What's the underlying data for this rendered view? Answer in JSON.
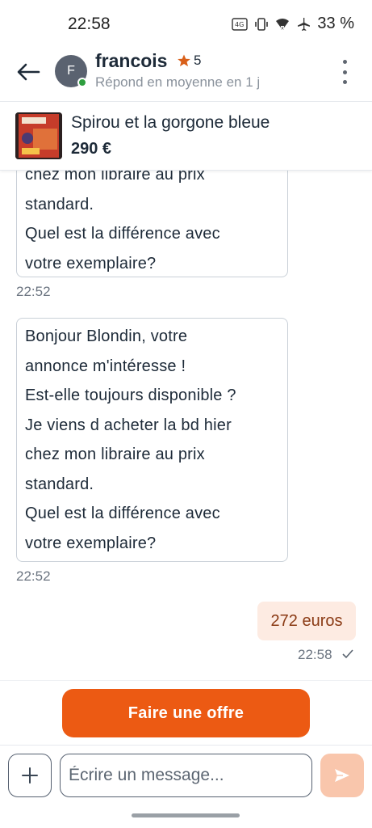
{
  "status_bar": {
    "time": "22:58",
    "battery": "33 %",
    "icons": [
      "hd-voice-icon",
      "vibrate-icon",
      "wifi-icon",
      "airplane-icon"
    ]
  },
  "header": {
    "back_icon": "arrow-left-icon",
    "avatar_initial": "F",
    "user_name": "francois",
    "rating": "5",
    "response_time": "Répond en moyenne en 1 j",
    "menu_icon": "more-vertical-icon"
  },
  "listing": {
    "title": "Spirou et la gorgone bleue",
    "price": "290 €"
  },
  "messages": [
    {
      "direction": "incoming",
      "lines": [
        "chez mon libraire au prix",
        "standard.",
        "Quel est la différence avec",
        "votre exemplaire?"
      ],
      "time": "22:52"
    },
    {
      "direction": "incoming",
      "lines": [
        "Bonjour Blondin, votre",
        "annonce m'intéresse !",
        "Est-elle toujours disponible ?",
        "Je viens d acheter la bd hier",
        "chez mon libraire au prix",
        "standard.",
        "Quel est la différence avec",
        "votre exemplaire?"
      ],
      "time": "22:52"
    },
    {
      "direction": "outgoing",
      "text": "272 euros",
      "time": "22:58"
    }
  ],
  "actions": {
    "offer_label": "Faire une offre"
  },
  "composer": {
    "placeholder": "Écrire un message...",
    "value": ""
  },
  "colors": {
    "accent": "#ec5a13",
    "send_disabled": "#f9c6ac",
    "outgoing_bubble": "#fdebe2",
    "online": "#2e9e3f",
    "star": "#d9601a"
  }
}
